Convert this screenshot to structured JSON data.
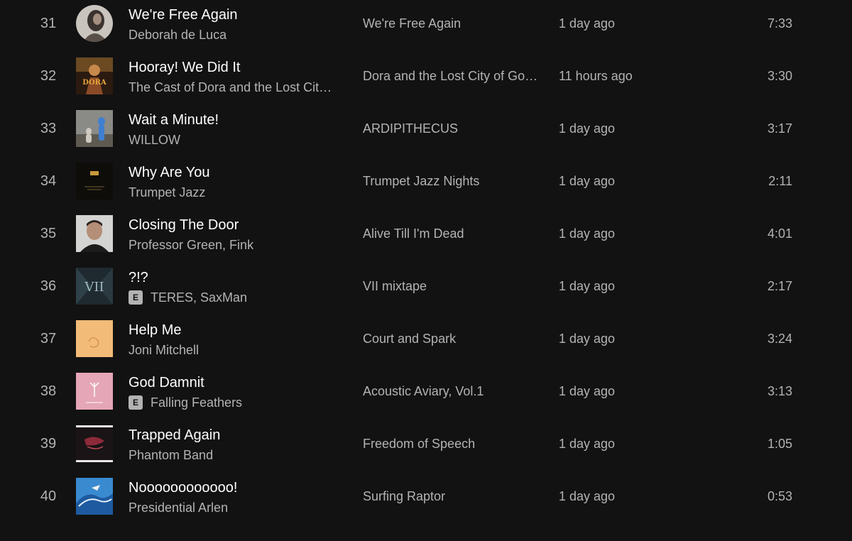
{
  "tracks": [
    {
      "index": "31",
      "title": "We're Free Again",
      "artist": "Deborah de Luca",
      "album": "We're Free Again",
      "added": "1 day ago",
      "duration": "7:33",
      "explicit": false
    },
    {
      "index": "32",
      "title": "Hooray! We Did It",
      "artist": "The Cast of Dora and the Lost Cit…",
      "album": "Dora and the Lost City of Go…",
      "added": "11 hours ago",
      "duration": "3:30",
      "explicit": false,
      "art_text": "DORA"
    },
    {
      "index": "33",
      "title": "Wait a Minute!",
      "artist": "WILLOW",
      "album": "ARDIPITHECUS",
      "added": "1 day ago",
      "duration": "3:17",
      "explicit": false
    },
    {
      "index": "34",
      "title": "Why Are You",
      "artist": "Trumpet Jazz",
      "album": "Trumpet Jazz Nights",
      "added": "1 day ago",
      "duration": "2:11",
      "explicit": false
    },
    {
      "index": "35",
      "title": "Closing The Door",
      "artist": "Professor Green, Fink",
      "album": "Alive Till I'm Dead",
      "added": "1 day ago",
      "duration": "4:01",
      "explicit": false
    },
    {
      "index": "36",
      "title": "?!?",
      "artist": "TERES, SaxMan",
      "album": "VII mixtape",
      "added": "1 day ago",
      "duration": "2:17",
      "explicit": true,
      "art_text": "VII"
    },
    {
      "index": "37",
      "title": "Help Me",
      "artist": "Joni Mitchell",
      "album": "Court and Spark",
      "added": "1 day ago",
      "duration": "3:24",
      "explicit": false
    },
    {
      "index": "38",
      "title": "God Damnit",
      "artist": "Falling Feathers",
      "album": "Acoustic Aviary, Vol.1",
      "added": "1 day ago",
      "duration": "3:13",
      "explicit": true
    },
    {
      "index": "39",
      "title": "Trapped Again",
      "artist": "Phantom Band",
      "album": "Freedom of Speech",
      "added": "1 day ago",
      "duration": "1:05",
      "explicit": false
    },
    {
      "index": "40",
      "title": "Noooooooooooo!",
      "artist": "Presidential Arlen",
      "album": "Surfing Raptor",
      "added": "1 day ago",
      "duration": "0:53",
      "explicit": false
    }
  ],
  "explicit_label": "E",
  "colors": {
    "background": "#121212",
    "primary_text": "#ffffff",
    "secondary_text": "#b3b3b3"
  }
}
